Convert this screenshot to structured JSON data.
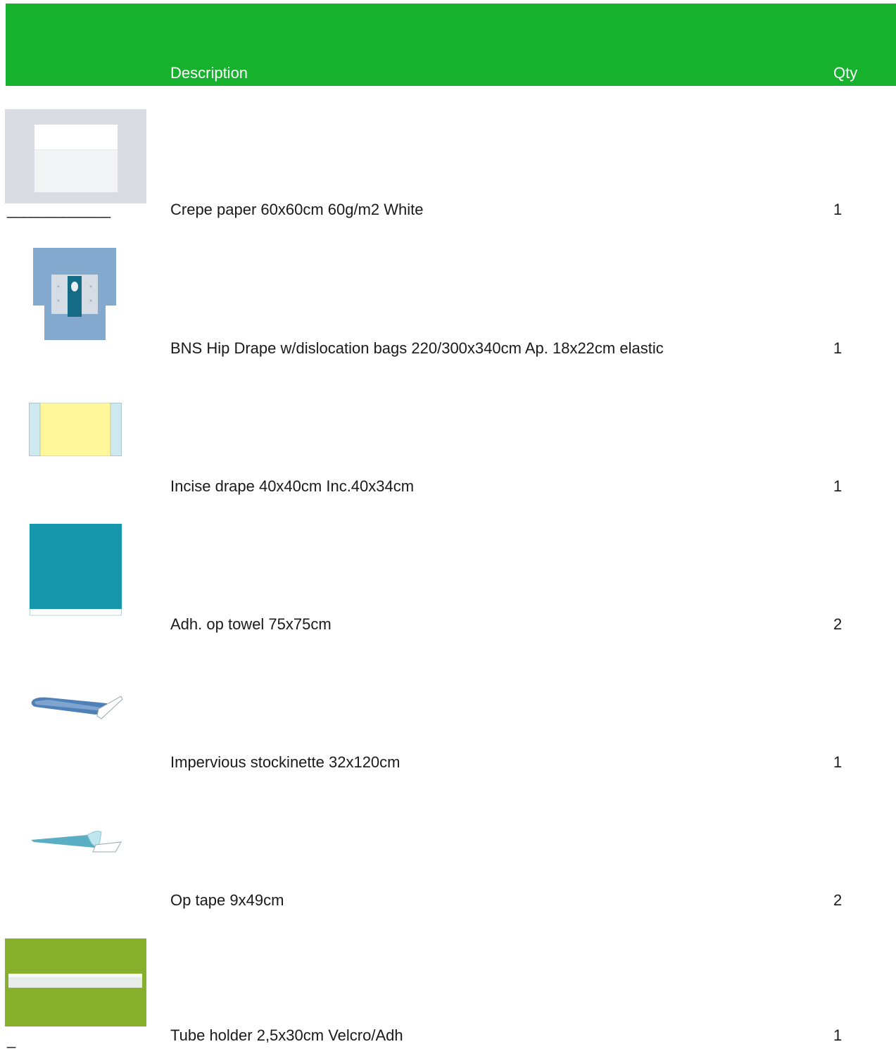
{
  "header": {
    "description_label": "Description",
    "qty_label": "Qty",
    "background": "#16b22e"
  },
  "items": [
    {
      "description": "Crepe paper 60x60cm 60g/m2 White",
      "qty": "1",
      "image": "white-crepe-paper-image",
      "underline": "_____________"
    },
    {
      "description": "BNS Hip Drape w/dislocation bags 220/300x340cm Ap. 18x22cm elastic",
      "qty": "1",
      "image": "blue-hip-drape-image"
    },
    {
      "description": "Incise drape 40x40cm Inc.40x34cm",
      "qty": "1",
      "image": "yellow-incise-drape-image"
    },
    {
      "description": "Adh. op towel 75x75cm",
      "qty": "2",
      "image": "teal-op-towel-image"
    },
    {
      "description": "Impervious stockinette 32x120cm",
      "qty": "1",
      "image": "blue-stockinette-image"
    },
    {
      "description": "Op tape 9x49cm",
      "qty": "2",
      "image": "light-blue-op-tape-image"
    },
    {
      "description": "Tube holder 2,5x30cm Velcro/Adh",
      "qty": "1",
      "image": "green-tube-holder-image",
      "underline": "_"
    }
  ]
}
